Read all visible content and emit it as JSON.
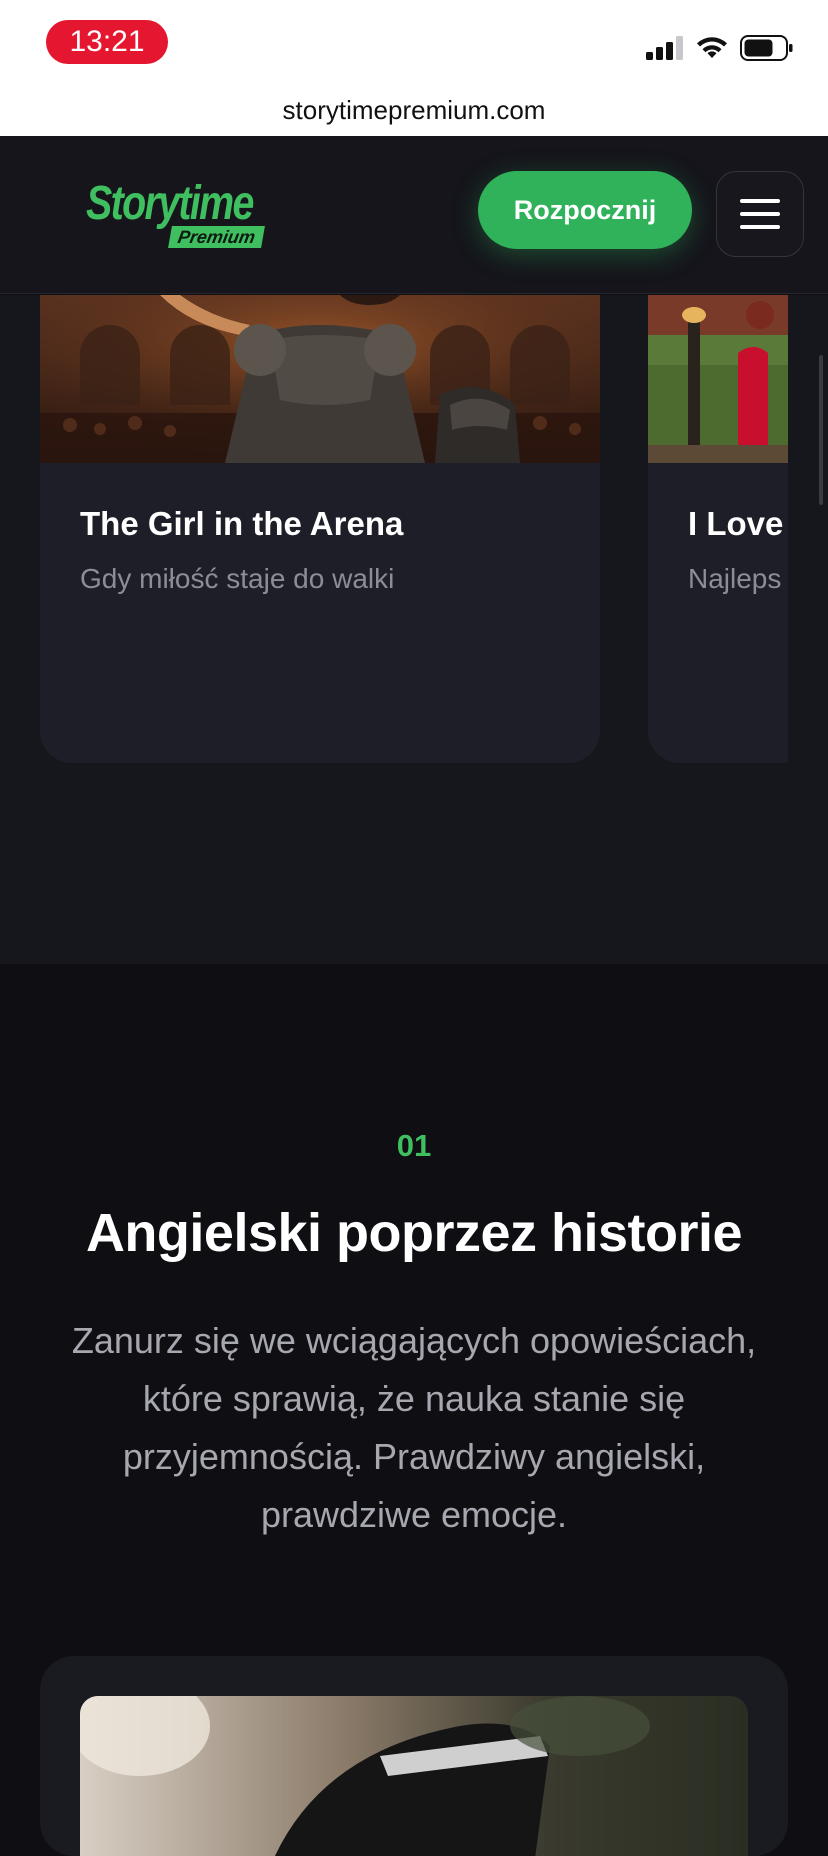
{
  "status_bar": {
    "time": "13:21",
    "icons": [
      "signal-icon",
      "wifi-icon",
      "battery-icon"
    ]
  },
  "browser": {
    "url": "storytimepremium.com"
  },
  "header": {
    "logo_main": "Storytime",
    "logo_sub": "Premium",
    "cta_label": "Rozpocznij",
    "colors": {
      "brand_green": "#2fb25a",
      "header_bg": "#15151b"
    }
  },
  "carousel": {
    "cards": [
      {
        "title": "The Girl in the Arena",
        "subtitle": "Gdy miłość staje do walki"
      },
      {
        "title": "I Love",
        "subtitle": "Najleps"
      }
    ]
  },
  "feature": {
    "number": "01",
    "title": "Angielski poprzez historie",
    "body": "Zanurz się we wciągających opowieściach, które sprawią, że nauka stanie się przyjemnością. Prawdziwy angielski, prawdziwe emocje."
  }
}
